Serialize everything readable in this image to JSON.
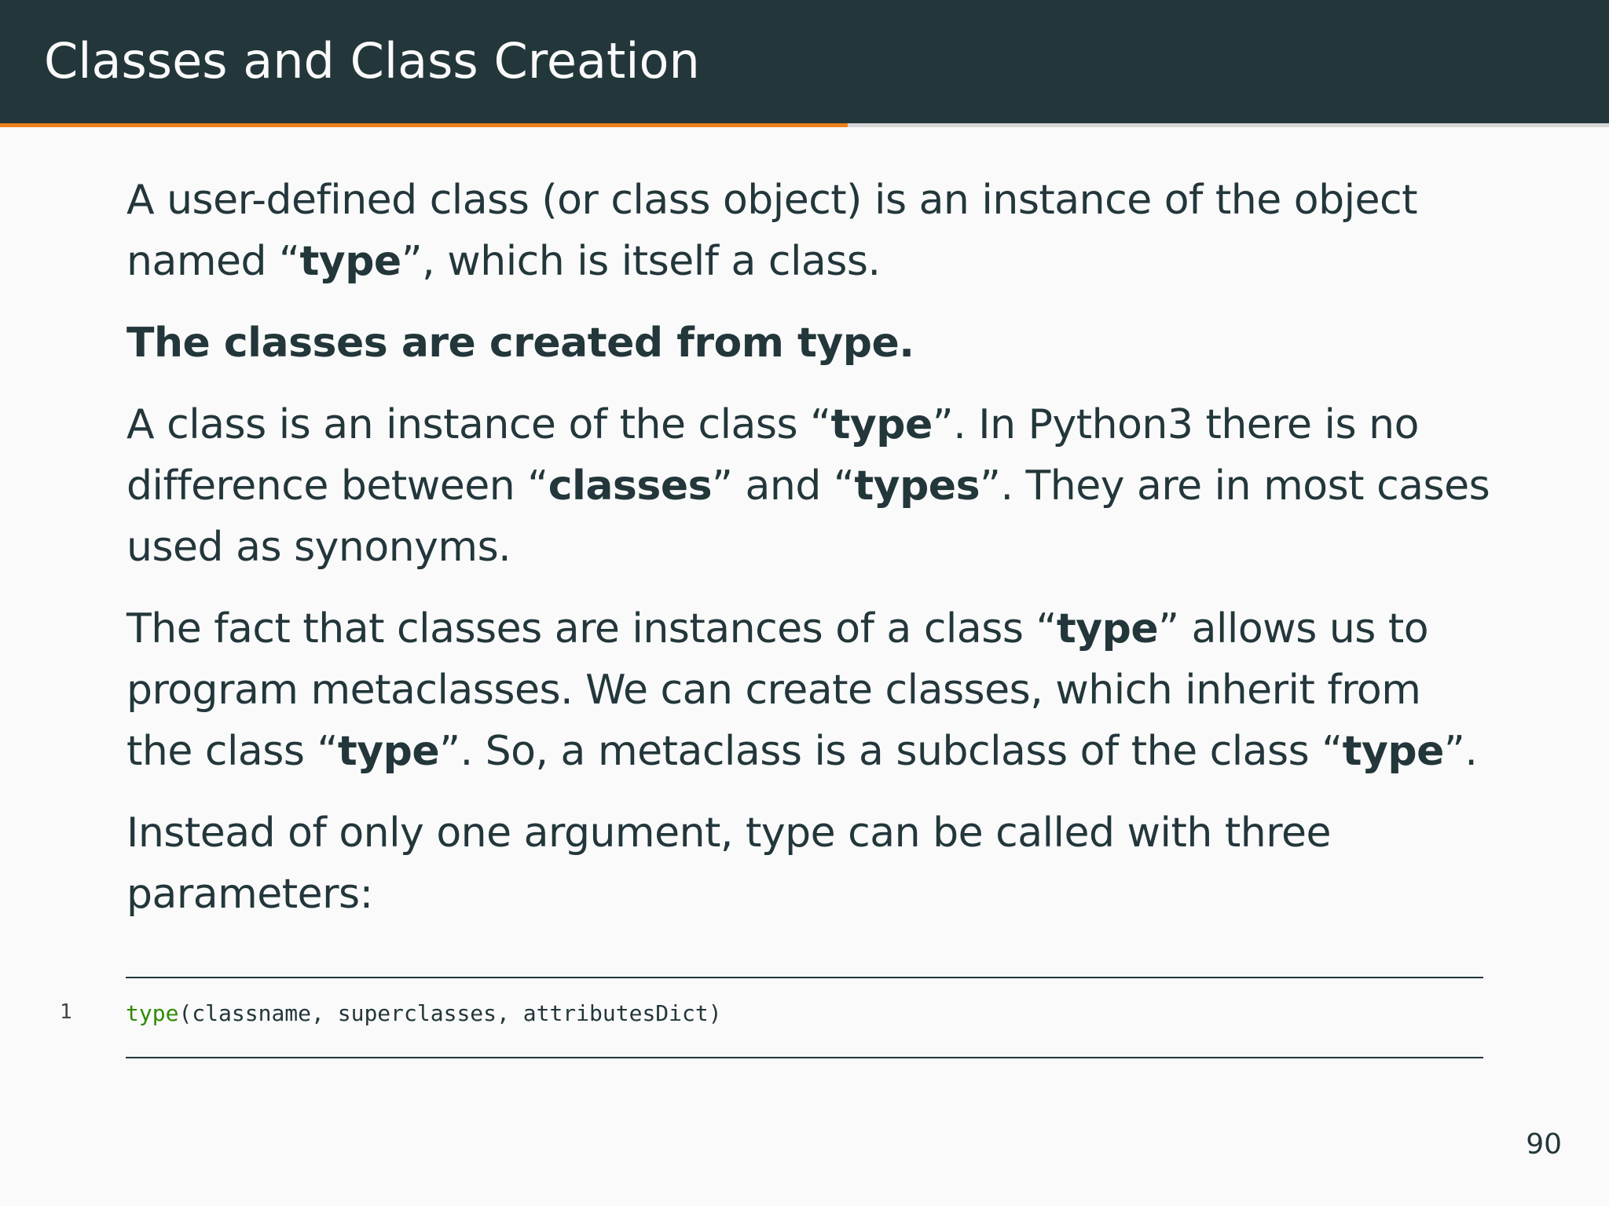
{
  "slide": {
    "title": "Classes and Class Creation",
    "progress_fraction": 0.527,
    "page_number": "90"
  },
  "paragraphs": [
    {
      "segments": [
        {
          "text": "A user-defined class (or class object) is an instance of the object named “",
          "bold": false
        },
        {
          "text": "type",
          "bold": true
        },
        {
          "text": "”, which is itself a class.",
          "bold": false
        }
      ]
    },
    {
      "segments": [
        {
          "text": "The classes are created from type.",
          "bold": true
        }
      ]
    },
    {
      "segments": [
        {
          "text": "A class is an instance of the class “",
          "bold": false
        },
        {
          "text": "type",
          "bold": true
        },
        {
          "text": "”. In Python3 there is no difference between “",
          "bold": false
        },
        {
          "text": "classes",
          "bold": true
        },
        {
          "text": "” and “",
          "bold": false
        },
        {
          "text": "types",
          "bold": true
        },
        {
          "text": "”. They are in most cases used as synonyms.",
          "bold": false
        }
      ]
    },
    {
      "segments": [
        {
          "text": "The fact that classes are instances of a class “",
          "bold": false
        },
        {
          "text": "type",
          "bold": true
        },
        {
          "text": "” allows us to program metaclasses. We can create classes, which inherit from the class “",
          "bold": false
        },
        {
          "text": "type",
          "bold": true
        },
        {
          "text": "”. So, a metaclass is a subclass of the class “",
          "bold": false
        },
        {
          "text": "type",
          "bold": true
        },
        {
          "text": "”.",
          "bold": false
        }
      ]
    },
    {
      "segments": [
        {
          "text": "Instead of only one argument, type can be called with three parameters:",
          "bold": false
        }
      ]
    }
  ],
  "code": {
    "line_number": "1",
    "keyword": "type",
    "rest": "(classname, superclasses, attributesDict)"
  },
  "colors": {
    "header_bg": "#23373b",
    "accent": "#eb811b",
    "keyword": "#2e8b00",
    "background": "#fafafa"
  }
}
